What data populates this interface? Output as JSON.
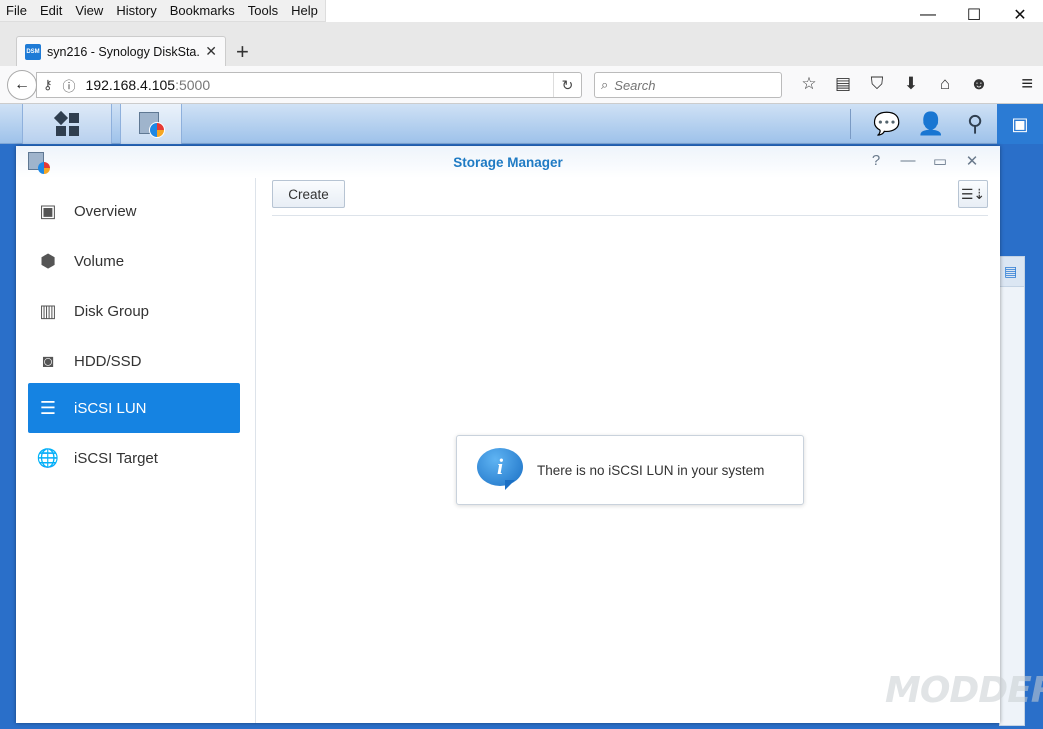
{
  "browser": {
    "menus": [
      "File",
      "Edit",
      "View",
      "History",
      "Bookmarks",
      "Tools",
      "Help"
    ],
    "tab": {
      "favicon_text": "DSM",
      "title": "syn216 - Synology DiskSta..."
    },
    "address": {
      "host": "192.168.4.105",
      "port": ":5000"
    },
    "search": {
      "placeholder": "Search"
    },
    "window_controls": {
      "minimize": "—",
      "maximize": "☐",
      "close": "✕"
    }
  },
  "window": {
    "title": "Storage Manager",
    "buttons": {
      "help": "?",
      "minimize": "—",
      "maximize": "▭",
      "close": "✕"
    }
  },
  "sidebar": {
    "items": [
      {
        "label": "Overview",
        "icon": "overview-icon"
      },
      {
        "label": "Volume",
        "icon": "cubes-icon"
      },
      {
        "label": "Disk Group",
        "icon": "disk-group-icon"
      },
      {
        "label": "HDD/SSD",
        "icon": "hdd-icon"
      },
      {
        "label": "iSCSI LUN",
        "icon": "database-icon",
        "active": true
      },
      {
        "label": "iSCSI Target",
        "icon": "globe-icon"
      }
    ]
  },
  "toolbar": {
    "create_label": "Create"
  },
  "main": {
    "empty_message": "There is no iSCSI LUN in your system",
    "info_glyph": "i"
  },
  "watermark": "MODDERS",
  "colors": {
    "accent": "#1583e2",
    "title": "#1f7bc4",
    "taskbar": "#b7d0ee"
  }
}
